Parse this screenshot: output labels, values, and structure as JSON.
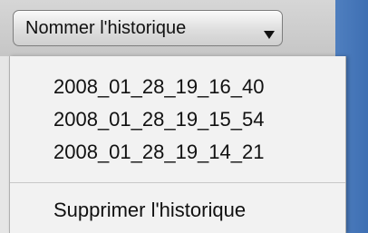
{
  "popup": {
    "label": "Nommer l'historique",
    "arrow_icon": "triangle-down"
  },
  "menu": {
    "history_items": [
      {
        "label": "2008_01_28_19_16_40"
      },
      {
        "label": "2008_01_28_19_15_54"
      },
      {
        "label": "2008_01_28_19_14_21"
      }
    ],
    "delete_label": "Supprimer l'historique"
  },
  "colors": {
    "window_accent": "#3e6fb3",
    "menu_background": "#f2f2f2",
    "text": "#111111"
  }
}
